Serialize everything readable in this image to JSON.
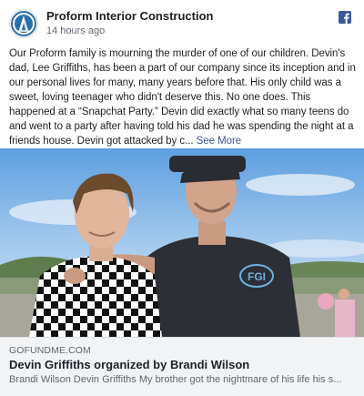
{
  "post": {
    "page_name": "Proform Interior Construction",
    "timestamp": "14 hours ago",
    "body": "Our Proform family is mourning the murder of one of our children. Devin's dad, Lee Griffiths, has been a part of our company since its inception and in our personal lives for many, many years before that. His only child was a sweet, loving teenager who didn't deserve this. No one does. This happened at a “Snapchat Party.” Devin did exactly what so many teens do and went to a party after having told his dad he was spending the night at a friends house. Devin got attacked by c...",
    "see_more": "See More",
    "share_icon": "facebook-icon",
    "avatar_icon": "proform-logo-icon"
  },
  "link": {
    "domain": "GOFUNDME.COM",
    "title": "Devin Griffiths organized by Brandi Wilson",
    "description": "Brandi Wilson Devin Griffiths My brother got the nightmare of his life his s..."
  },
  "photo": {
    "shirt_logo": "FGI"
  },
  "colors": {
    "facebook_blue": "#3b5998",
    "link_blue": "#385898",
    "link_box_bg": "#f2f3f5"
  }
}
